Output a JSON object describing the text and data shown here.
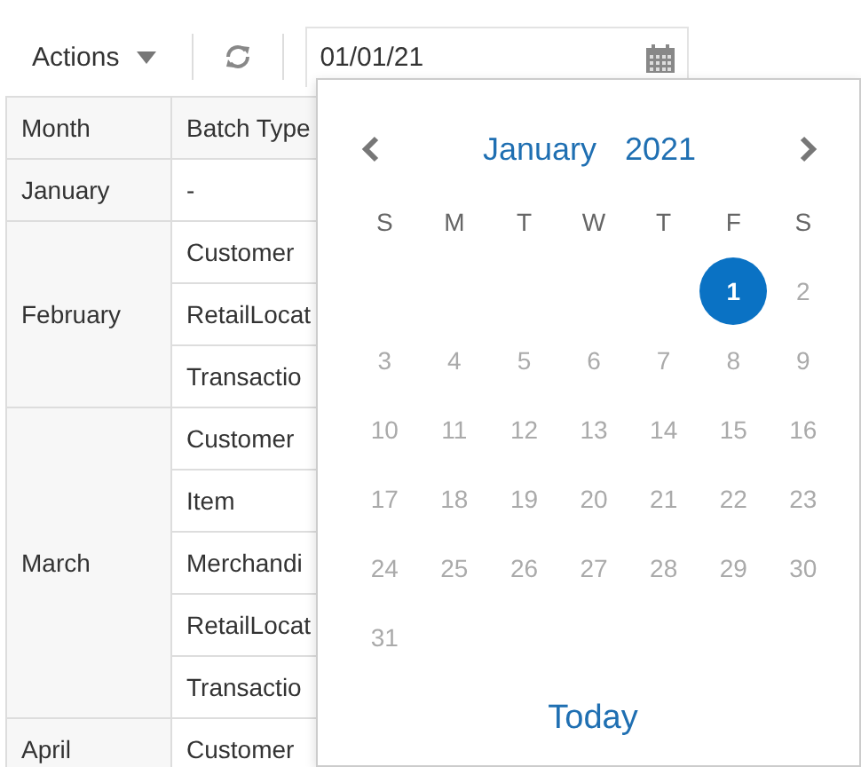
{
  "toolbar": {
    "actions_label": "Actions",
    "date_value": "01/01/21"
  },
  "table": {
    "columns": [
      "Month",
      "Batch Type"
    ],
    "groups": [
      {
        "month": "January",
        "batch_types": [
          "-"
        ]
      },
      {
        "month": "February",
        "batch_types": [
          "Customer",
          "RetailLocat",
          "Transactio"
        ]
      },
      {
        "month": "March",
        "batch_types": [
          "Customer",
          "Item",
          "Merchandi",
          "RetailLocat",
          "Transactio"
        ]
      },
      {
        "month": "April",
        "batch_types": [
          "Customer"
        ]
      }
    ]
  },
  "calendar": {
    "month": "January",
    "year": "2021",
    "weekdays": [
      "S",
      "M",
      "T",
      "W",
      "T",
      "F",
      "S"
    ],
    "weeks": [
      [
        {
          "kind": "blank"
        },
        {
          "kind": "blank"
        },
        {
          "kind": "blank"
        },
        {
          "kind": "blank"
        },
        {
          "kind": "blank"
        },
        {
          "kind": "day",
          "day": "1",
          "selected": true
        },
        {
          "kind": "day",
          "day": "2",
          "selected": false
        }
      ],
      [
        {
          "kind": "day",
          "day": "3",
          "selected": false
        },
        {
          "kind": "day",
          "day": "4",
          "selected": false
        },
        {
          "kind": "day",
          "day": "5",
          "selected": false
        },
        {
          "kind": "day",
          "day": "6",
          "selected": false
        },
        {
          "kind": "day",
          "day": "7",
          "selected": false
        },
        {
          "kind": "day",
          "day": "8",
          "selected": false
        },
        {
          "kind": "day",
          "day": "9",
          "selected": false
        }
      ],
      [
        {
          "kind": "day",
          "day": "10",
          "selected": false
        },
        {
          "kind": "day",
          "day": "11",
          "selected": false
        },
        {
          "kind": "day",
          "day": "12",
          "selected": false
        },
        {
          "kind": "day",
          "day": "13",
          "selected": false
        },
        {
          "kind": "day",
          "day": "14",
          "selected": false
        },
        {
          "kind": "day",
          "day": "15",
          "selected": false
        },
        {
          "kind": "day",
          "day": "16",
          "selected": false
        }
      ],
      [
        {
          "kind": "day",
          "day": "17",
          "selected": false
        },
        {
          "kind": "day",
          "day": "18",
          "selected": false
        },
        {
          "kind": "day",
          "day": "19",
          "selected": false
        },
        {
          "kind": "day",
          "day": "20",
          "selected": false
        },
        {
          "kind": "day",
          "day": "21",
          "selected": false
        },
        {
          "kind": "day",
          "day": "22",
          "selected": false
        },
        {
          "kind": "day",
          "day": "23",
          "selected": false
        }
      ],
      [
        {
          "kind": "day",
          "day": "24",
          "selected": false
        },
        {
          "kind": "day",
          "day": "25",
          "selected": false
        },
        {
          "kind": "day",
          "day": "26",
          "selected": false
        },
        {
          "kind": "day",
          "day": "27",
          "selected": false
        },
        {
          "kind": "day",
          "day": "28",
          "selected": false
        },
        {
          "kind": "day",
          "day": "29",
          "selected": false
        },
        {
          "kind": "day",
          "day": "30",
          "selected": false
        }
      ],
      [
        {
          "kind": "day",
          "day": "31",
          "selected": false
        }
      ]
    ],
    "today_label": "Today"
  }
}
